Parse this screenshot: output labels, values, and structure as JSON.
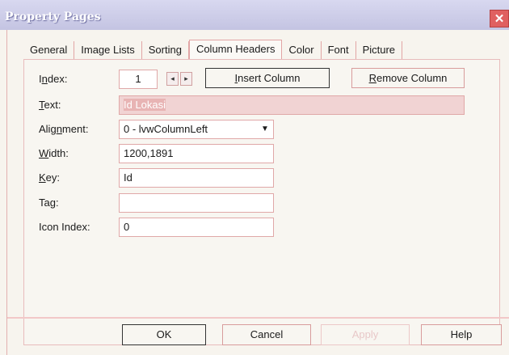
{
  "window": {
    "title": "Property Pages",
    "close_glyph": "✕"
  },
  "tabs": [
    "General",
    "Image Lists",
    "Sorting",
    "Column Headers",
    "Color",
    "Font",
    "Picture"
  ],
  "active_tab": "Column Headers",
  "index": {
    "label_pre": "I",
    "label_u": "n",
    "label_post": "dex:",
    "value": "1",
    "left_arrow": "◂",
    "right_arrow": "▸"
  },
  "insert_button": {
    "u": "I",
    "rest": "nsert Column"
  },
  "remove_button": {
    "u": "R",
    "rest": "emove Column"
  },
  "text": {
    "label_u": "T",
    "label_post": "ext:",
    "value": "Id Lokasi"
  },
  "alignment": {
    "label_pre": "Alig",
    "label_u": "n",
    "label_post": "ment:",
    "value": "0 - lvwColumnLeft",
    "arrow": "▼"
  },
  "width": {
    "label_u": "W",
    "label_post": "idth:",
    "value": "1200,1891"
  },
  "key": {
    "label_u": "K",
    "label_post": "ey:",
    "value": "Id"
  },
  "tag": {
    "label_pre": "Ta",
    "label_u": "g",
    "label_post": ":",
    "value": ""
  },
  "icon_index": {
    "label": "Icon Index:",
    "value": "0"
  },
  "buttons": {
    "ok": "OK",
    "cancel": "Cancel",
    "apply": "Apply",
    "help": "Help"
  }
}
